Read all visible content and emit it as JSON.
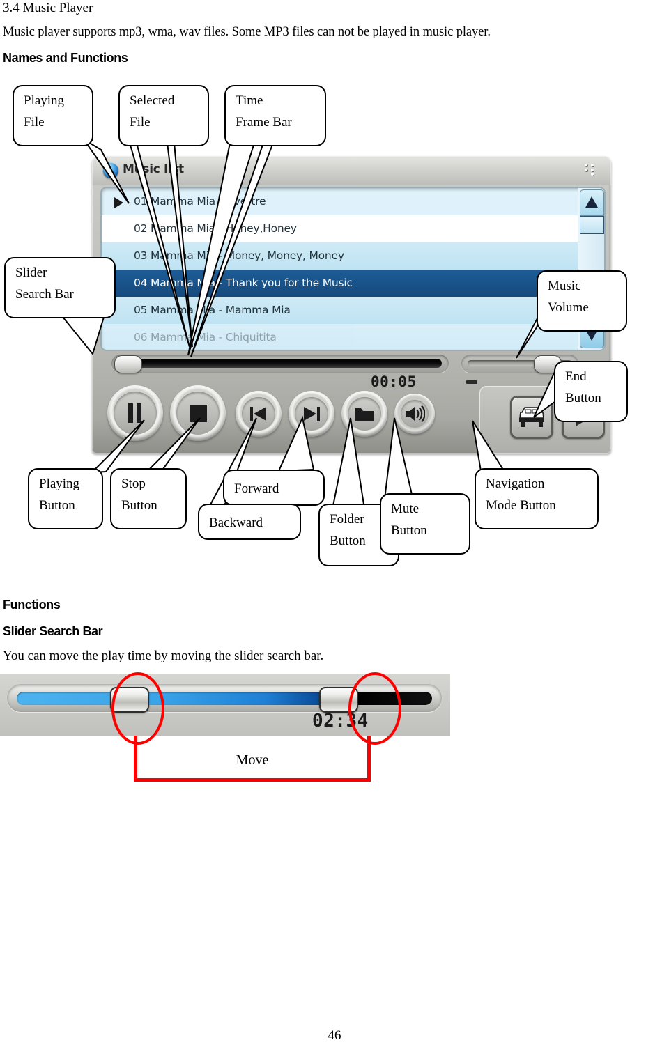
{
  "document": {
    "section_title": "3.4 Music Player",
    "intro": "Music player supports mp3, wma, wav files.   Some MP3 files can not be played in music player.",
    "names_heading": "Names and Functions",
    "functions_heading": "Functions",
    "slider_heading": "Slider Search Bar",
    "slider_description": "You can move the play time by moving the slider search bar.",
    "page_number": "46"
  },
  "callouts": [
    {
      "id": "playing-file",
      "lines": [
        "Playing",
        "File"
      ]
    },
    {
      "id": "selected-file",
      "lines": [
        "Selected",
        "File"
      ]
    },
    {
      "id": "time-frame-bar",
      "lines": [
        "Time",
        "Frame Bar"
      ]
    },
    {
      "id": "slider-search-bar",
      "lines": [
        "Slider",
        "Search Bar"
      ]
    },
    {
      "id": "music-volume",
      "lines": [
        "Music",
        "Volume"
      ]
    },
    {
      "id": "end-button",
      "lines": [
        "End",
        "Button"
      ]
    },
    {
      "id": "playing-button",
      "lines": [
        "Playing",
        "Button"
      ]
    },
    {
      "id": "stop-button",
      "lines": [
        "Stop",
        "Button"
      ]
    },
    {
      "id": "forward",
      "lines": [
        "Forward"
      ]
    },
    {
      "id": "backward",
      "lines": [
        "Backward"
      ]
    },
    {
      "id": "folder-button",
      "lines": [
        "Folder",
        "Button"
      ]
    },
    {
      "id": "mute-button",
      "lines": [
        "Mute",
        "Button"
      ]
    },
    {
      "id": "navigation-mode-button",
      "lines": [
        "Navigation",
        "Mode Button"
      ]
    }
  ],
  "player": {
    "title": "Music list",
    "time": "00:05",
    "tracks": [
      {
        "label": "01 Mamma Mia - Overtre",
        "state": "playing"
      },
      {
        "label": "02 Mamma Mia - Honey,Honey",
        "state": "alt"
      },
      {
        "label": "03 Mamma Mia - Money, Money, Money",
        "state": "lite"
      },
      {
        "label": "04 Mamma Mia - Thank you for the Music",
        "state": "selected"
      },
      {
        "label": "05 Mamma Mia - Mamma Mia",
        "state": "lite"
      },
      {
        "label": "06 Mamma Mia - Chiquitita",
        "state": "cut"
      }
    ],
    "buttons": {
      "play": "play-pause-button",
      "stop": "stop-button",
      "backward": "backward-button",
      "forward": "forward-button",
      "folder": "folder-button",
      "mute": "mute-speaker-button",
      "navigation": "navigation-mode-button",
      "end": "end-button"
    }
  },
  "figure": {
    "time": "02:34",
    "move_label": "Move"
  },
  "colors": {
    "annotation_red": "#ff0000",
    "selected_row": "#154a7e",
    "list_row_light": "#cfeaf6",
    "slider_blue": "#2f9fe4"
  }
}
